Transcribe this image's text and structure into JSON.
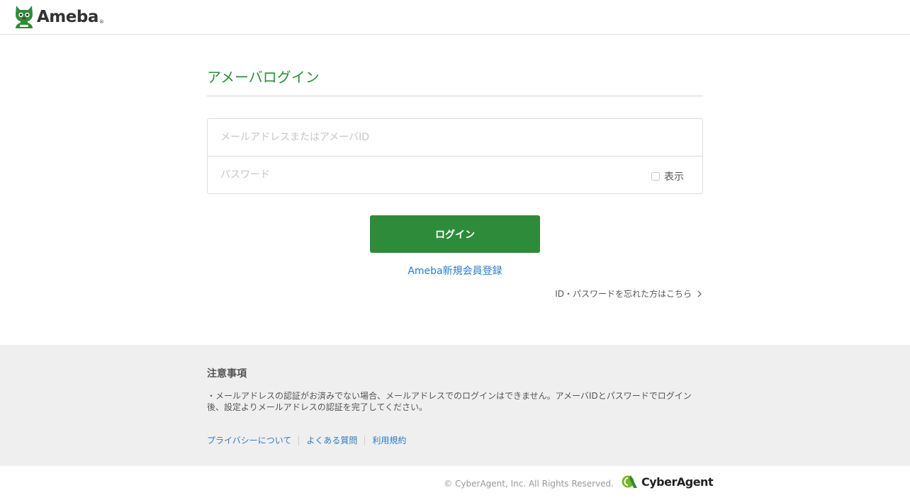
{
  "header": {
    "logo_text": "Ameba",
    "logo_reg": "®"
  },
  "login": {
    "title": "アメーバログイン",
    "email_placeholder": "メールアドレスまたはアメーバID",
    "password_placeholder": "パスワード",
    "show_label": "表示",
    "submit_label": "ログイン",
    "signup_label": "Ameba新規会員登録",
    "forgot_label": "ID・パスワードを忘れた方はこちら"
  },
  "notice": {
    "title": "注意事項",
    "body": "・メールアドレスの認証がお済みでない場合、メールアドレスでのログインはできません。アメーバIDとパスワードでログイン後、設定よりメールアドレスの認証を完了してください。",
    "links": [
      "プライバシーについて",
      "よくある質問",
      "利用規約"
    ]
  },
  "footer": {
    "copyright": "© CyberAgent, Inc. All Rights Reserved.",
    "company_logo_text": "CyberAgent"
  },
  "colors": {
    "brand_green": "#2e8b3a",
    "title_green": "#2d8c3c",
    "link_blue": "#2a7cc7"
  }
}
